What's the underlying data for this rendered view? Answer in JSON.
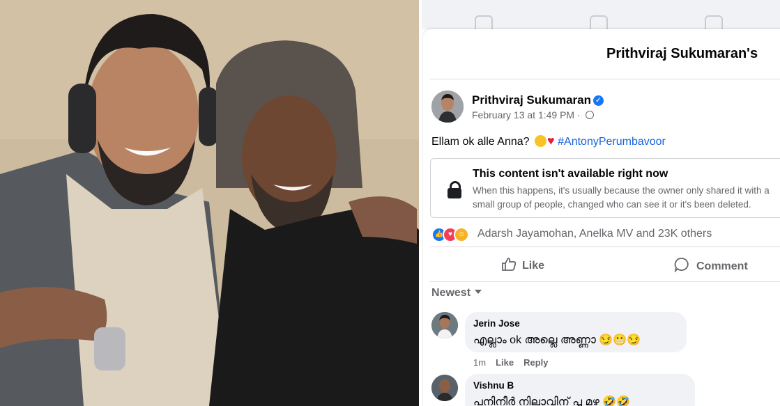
{
  "post": {
    "page_title": "Prithviraj Sukumaran's",
    "author": "Prithviraj Sukumaran",
    "timestamp": "February 13 at 1:49 PM",
    "separator": "·",
    "text": "Ellam ok alle Anna?",
    "hashtag": "#AntonyPerumbavoor"
  },
  "unavailable": {
    "title": "This content isn't available right now",
    "description": "When this happens, it's usually because the owner only shared it with a small group of people, changed who can see it or it's been deleted."
  },
  "reactions": {
    "summary": "Adarsh Jayamohan, Anelka MV and 23K others",
    "colors": {
      "like": "#1877f2",
      "love": "#f33e58",
      "haha": "#f7b125"
    }
  },
  "actions": {
    "like_label": "Like",
    "comment_label": "Comment"
  },
  "comments": {
    "sort_label": "Newest",
    "items": [
      {
        "name": "Jerin Jose",
        "text": "എല്ലാം ok അല്ലെ അണ്ണാ 😏😬😏",
        "time": "1m",
        "like": "Like",
        "reply": "Reply"
      },
      {
        "name": "Vishnu B",
        "text": "പനിനീർ നിലാവിന് പൂ മഴ 🤣🤣",
        "time": "",
        "like": "",
        "reply": ""
      }
    ]
  },
  "icons": [
    "verified-badge-icon",
    "globe-icon",
    "lock-icon",
    "like-reaction-icon",
    "love-reaction-icon",
    "haha-reaction-icon",
    "like-icon",
    "comment-icon",
    "caret-down-icon",
    "home-nav-icon",
    "watch-nav-icon",
    "marketplace-nav-icon"
  ],
  "colors": {
    "accent": "#1877f2",
    "hashtag": "#1664d9",
    "muted": "#65676b"
  }
}
